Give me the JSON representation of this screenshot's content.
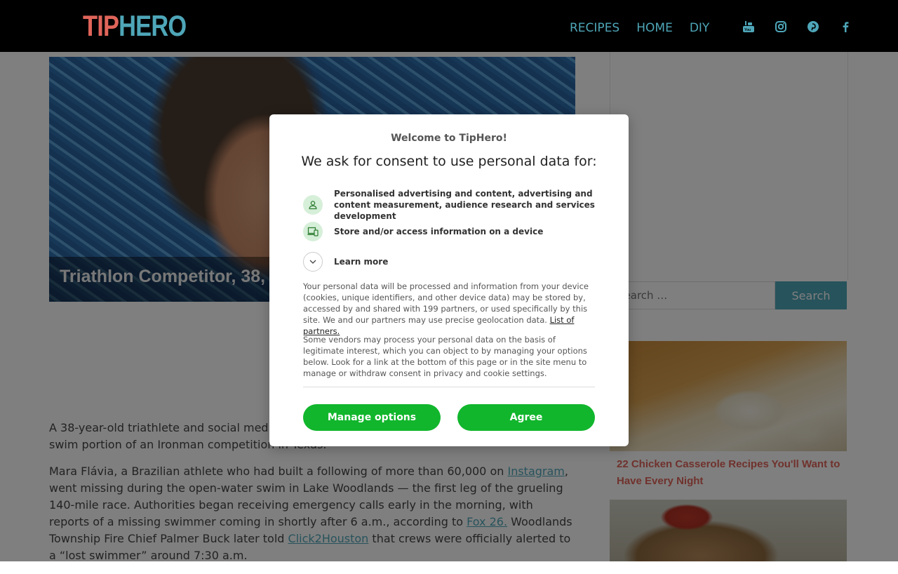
{
  "header": {
    "logo_tip": "TIP",
    "logo_hero": "HERO",
    "nav": [
      "RECIPES",
      "HOME",
      "DIY"
    ],
    "social_icons": [
      "youtube-icon",
      "instagram-icon",
      "pinterest-icon",
      "facebook-icon"
    ],
    "accent_color": "#4ea6b8",
    "logo_red": "#e0645a"
  },
  "hero": {
    "caption": "Triathlon Competitor, 38, Die"
  },
  "article": {
    "p1_start": "A 38-year-old triathlete and social media i",
    "p1_end": "swim portion of an Ironman competition in Texas.",
    "p2_a": "Mara Flávia, a Brazilian athlete who had built a following of more than 60,000 on ",
    "p2_link1": "Instagram",
    "p2_b": ", went missing during the open-water swim in Lake Woodlands — the first leg of the grueling 140-mile race. Authorities began receiving emergency calls early in the morning, with reports of a missing swimmer coming in shortly after 6 a.m., according to ",
    "p2_link2": "Fox 26.",
    "p2_c": " Woodlands Township Fire Chief Palmer Buck later told ",
    "p2_link3": "Click2Houston",
    "p2_d": " that crews were officially alerted to a “lost swimmer” around 7:30 a.m."
  },
  "sidebar": {
    "search_placeholder": "Search …",
    "search_button": "Search",
    "card1_title": "22 Chicken Casserole Recipes You'll Want to Have Every Night"
  },
  "consent": {
    "welcome": "Welcome to TipHero!",
    "title": "We ask for consent to use personal data for:",
    "purpose1": "Personalised advertising and content, advertising and content measurement, audience research and services development",
    "purpose2": "Store and/or access information on a device",
    "learn_more": "Learn more",
    "para1": "Your personal data will be processed and information from your device (cookies, unique identifiers, and other device data) may be stored by, accessed by and shared with 199 partners, or used specifically by this site. We and our partners may use precise geolocation data. ",
    "partners_link": "List of partners.",
    "para2": "Some vendors may process your personal data on the basis of legitimate interest, which you can object to by managing your options below. Look for a link at the bottom of this page or in the site menu to manage or withdraw consent in privacy and cookie settings.",
    "manage_button": "Manage options",
    "agree_button": "Agree",
    "button_color": "#11b62c"
  }
}
